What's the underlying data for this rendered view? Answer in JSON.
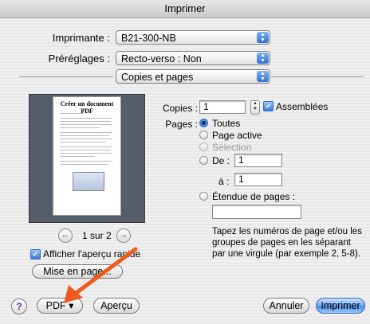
{
  "window": {
    "title": "Imprimer"
  },
  "printer": {
    "label": "Imprimante :",
    "value": "B21-300-NB"
  },
  "presets": {
    "label": "Préréglages :",
    "value": "Recto-verso : Non"
  },
  "section": {
    "value": "Copies et pages"
  },
  "preview": {
    "page_title": "Créer un document PDF",
    "page_indicator": "1 sur 2",
    "quick_preview_label": "Afficher l'aperçu rapide",
    "quick_preview_checked": true,
    "page_setup_button": "Mise en page..."
  },
  "copies": {
    "label": "Copies :",
    "value": "1",
    "collated_label": "Assemblées",
    "collated_checked": true
  },
  "pages": {
    "label": "Pages :",
    "options": {
      "all": "Toutes",
      "current": "Page active",
      "selection": "Sélection",
      "from": "De :",
      "to": "à :",
      "range": "Étendue de pages :"
    },
    "selected": "all",
    "from_value": "1",
    "to_value": "1",
    "range_value": "",
    "hint": "Tapez les numéros de page et/ou les groupes de pages en les séparant par une virgule (par exemple 2, 5-8)."
  },
  "footer": {
    "help": "?",
    "pdf_button": "PDF ▾",
    "preview_button": "Aperçu",
    "cancel_button": "Annuler",
    "print_button": "Imprimer"
  },
  "colors": {
    "accent": "#4c8ce6",
    "annotation_arrow": "#f05a1e"
  }
}
